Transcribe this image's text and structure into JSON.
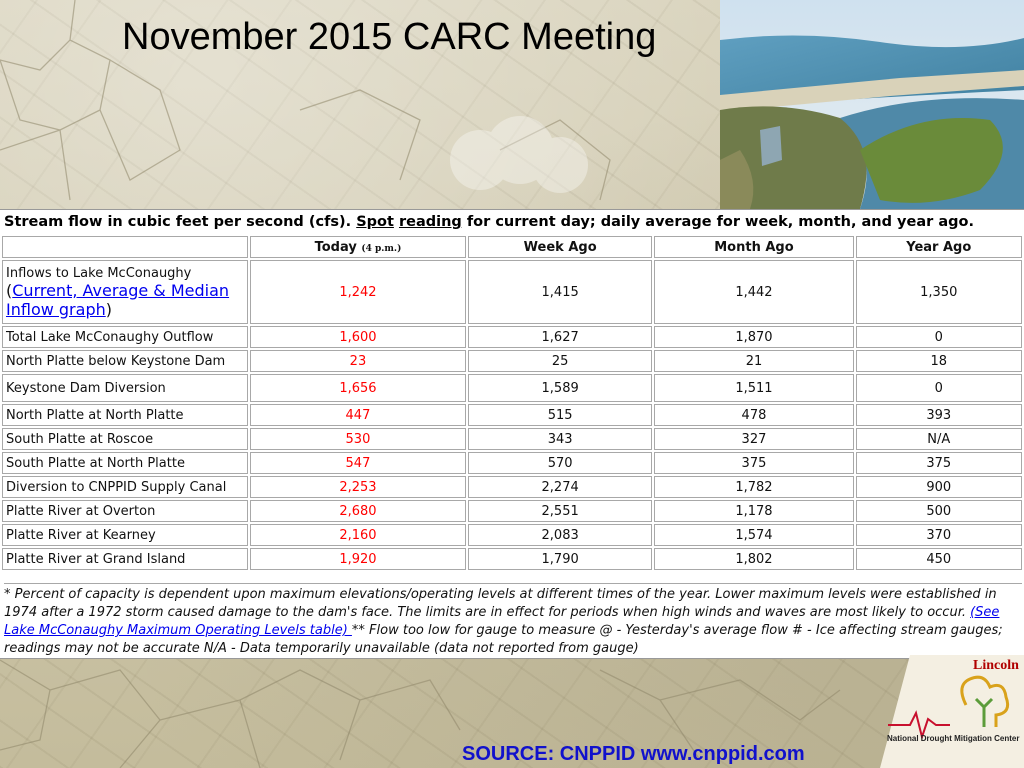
{
  "slide": {
    "title": "November 2015 CARC Meeting",
    "source": "SOURCE: CNPPID www.cnppid.com"
  },
  "table": {
    "caption_prefix": "Stream flow in cubic feet per second (cfs). ",
    "caption_spot": "Spot",
    "caption_reading": "reading",
    "caption_suffix": " for current day; daily average for week, month, and year ago.",
    "headers": {
      "today": "Today",
      "today_time": "(4 p.m.)",
      "week": "Week Ago",
      "month": "Month Ago",
      "year": "Year Ago"
    },
    "inflow_label": "Inflows to Lake McConaughy",
    "inflow_paren_open": "(",
    "inflow_link": "Current, Average & Median Inflow graph",
    "inflow_paren_close": ")",
    "rows": [
      {
        "label": "Inflows to Lake McConaughy",
        "today": "1,242",
        "week": "1,415",
        "month": "1,442",
        "year": "1,350"
      },
      {
        "label": "Total Lake McConaughy Outflow",
        "today": "1,600",
        "week": "1,627",
        "month": "1,870",
        "year": "0"
      },
      {
        "label": "North Platte below Keystone Dam",
        "today": "23",
        "week": "25",
        "month": "21",
        "year": "18"
      },
      {
        "label": "Keystone Dam Diversion",
        "today": "1,656",
        "week": "1,589",
        "month": "1,511",
        "year": "0"
      },
      {
        "label": "North Platte at North Platte",
        "today": "447",
        "week": "515",
        "month": "478",
        "year": "393"
      },
      {
        "label": "South Platte at Roscoe",
        "today": "530",
        "week": "343",
        "month": "327",
        "year": "N/A"
      },
      {
        "label": "South Platte at North Platte",
        "today": "547",
        "week": "570",
        "month": "375",
        "year": "375"
      },
      {
        "label": "Diversion to CNPPID Supply Canal",
        "today": "2,253",
        "week": "2,274",
        "month": "1,782",
        "year": "900"
      },
      {
        "label": "Platte River at Overton",
        "today": "2,680",
        "week": "2,551",
        "month": "1,178",
        "year": "500"
      },
      {
        "label": "Platte River at Kearney",
        "today": "2,160",
        "week": "2,083",
        "month": "1,574",
        "year": "370"
      },
      {
        "label": "Platte River at Grand Island",
        "today": "1,920",
        "week": "1,790",
        "month": "1,802",
        "year": "450"
      }
    ],
    "footnote_part1": "* Percent of capacity is dependent upon maximum elevations/operating levels at different times of the year. Lower maximum levels were established in 1974 after a 1972 storm caused damage to the dam's face. The limits are in effect for periods when high winds and waves are most likely to occur. ",
    "footnote_link": "(See Lake McConaughy Maximum Operating Levels table) ",
    "footnote_part2": "** Flow too low for gauge to measure @ - Yesterday's average flow # - Ice affecting stream gauges; readings may not be accurate N/A - Data temporarily unavailable (data not reported from gauge)"
  },
  "logo": {
    "lincoln": "Lincoln",
    "name": "National  Drought Mitigation Center"
  },
  "colors": {
    "today_value": "#ff0000",
    "link": "#0000ee",
    "source_text": "#1111cc"
  }
}
